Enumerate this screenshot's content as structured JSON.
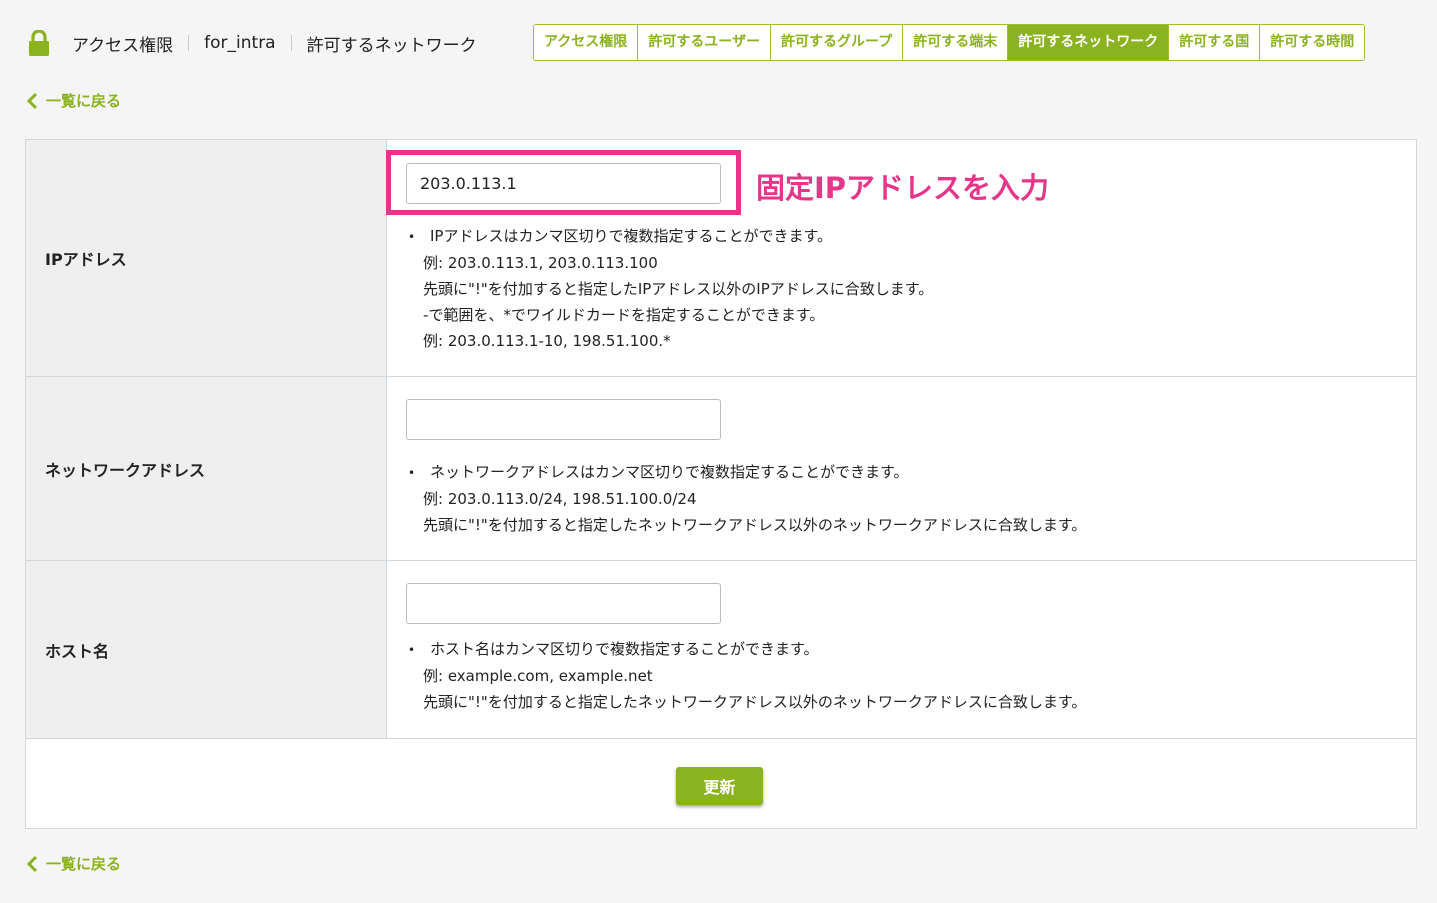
{
  "header": {
    "breadcrumb": [
      "アクセス権限",
      "for_intra",
      "許可するネットワーク"
    ],
    "tabs": [
      {
        "label": "アクセス権限",
        "active": false
      },
      {
        "label": "許可するユーザー",
        "active": false
      },
      {
        "label": "許可するグループ",
        "active": false
      },
      {
        "label": "許可する端末",
        "active": false
      },
      {
        "label": "許可するネットワーク",
        "active": true
      },
      {
        "label": "許可する国",
        "active": false
      },
      {
        "label": "許可する時間",
        "active": false
      }
    ]
  },
  "back_link": "一覧に戻る",
  "form": {
    "ip": {
      "label": "IPアドレス",
      "value": "203.0.113.1",
      "help": [
        "IPアドレスはカンマ区切りで複数指定することができます。",
        "例: 203.0.113.1, 203.0.113.100",
        "先頭に\"!\"を付加すると指定したIPアドレス以外のIPアドレスに合致します。",
        "-で範囲を、*でワイルドカードを指定することができます。",
        "例: 203.0.113.1-10, 198.51.100.*"
      ]
    },
    "network": {
      "label": "ネットワークアドレス",
      "value": "",
      "help": [
        "ネットワークアドレスはカンマ区切りで複数指定することができます。",
        "例: 203.0.113.0/24, 198.51.100.0/24",
        "先頭に\"!\"を付加すると指定したネットワークアドレス以外のネットワークアドレスに合致します。"
      ]
    },
    "host": {
      "label": "ホスト名",
      "value": "",
      "help": [
        "ホスト名はカンマ区切りで複数指定することができます。",
        "例: example.com, example.net",
        "先頭に\"!\"を付加すると指定したネットワークアドレス以外のネットワークアドレスに合致します。"
      ]
    },
    "submit_label": "更新"
  },
  "annotation": "固定IPアドレスを入力",
  "colors": {
    "accent": "#8bb21f",
    "highlight": "#e5378a"
  },
  "icons": [
    "lock-icon",
    "chevron-left-icon"
  ]
}
